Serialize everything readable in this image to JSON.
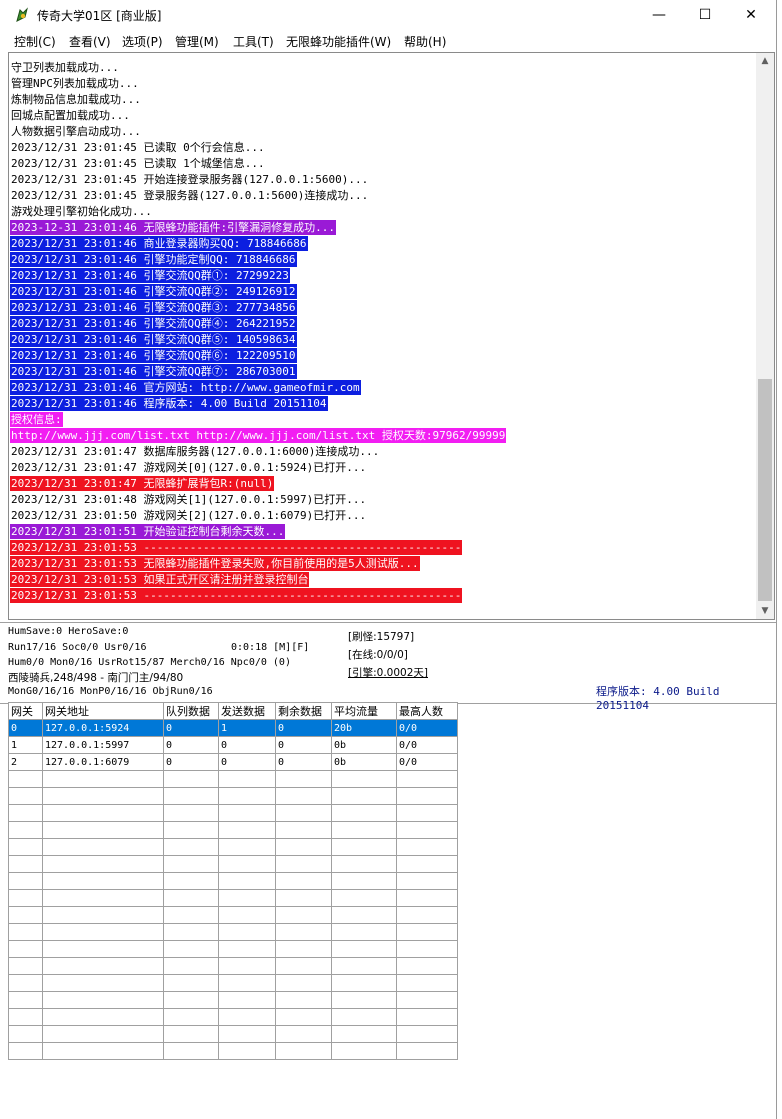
{
  "window": {
    "title": "传奇大学01区 [商业版]",
    "minimize": "—",
    "maximize": "☐",
    "close": "✕"
  },
  "menu": [
    "控制(C)",
    "查看(V)",
    "选项(P)",
    "管理(M)",
    "工具(T)",
    "无限蜂功能插件(W)",
    "帮助(H)"
  ],
  "log": [
    {
      "text": "守卫列表加载成功...",
      "style": ""
    },
    {
      "text": "管理NPC列表加载成功...",
      "style": ""
    },
    {
      "text": "炼制物品信息加载成功...",
      "style": ""
    },
    {
      "text": "回城点配置加载成功...",
      "style": ""
    },
    {
      "text": "人物数据引擎启动成功...",
      "style": ""
    },
    {
      "text": "2023/12/31 23:01:45 已读取 0个行会信息...",
      "style": ""
    },
    {
      "text": "2023/12/31 23:01:45 已读取 1个城堡信息...",
      "style": ""
    },
    {
      "text": "2023/12/31 23:01:45 开始连接登录服务器(127.0.0.1:5600)...",
      "style": ""
    },
    {
      "text": "2023/12/31 23:01:45 登录服务器(127.0.0.1:5600)连接成功...",
      "style": ""
    },
    {
      "text": "游戏处理引擎初始化成功...",
      "style": ""
    },
    {
      "text": "2023-12-31 23:01:46 无限蜂功能插件:引擎漏洞修复成功...",
      "style": "purple"
    },
    {
      "text": "2023/12/31 23:01:46 商业登录器购买QQ: 718846686",
      "style": "blue"
    },
    {
      "text": "2023/12/31 23:01:46 引擎功能定制QQ: 718846686",
      "style": "blue"
    },
    {
      "text": "2023/12/31 23:01:46 引擎交流QQ群①: 27299223",
      "style": "blue"
    },
    {
      "text": "2023/12/31 23:01:46 引擎交流QQ群②: 249126912",
      "style": "blue"
    },
    {
      "text": "2023/12/31 23:01:46 引擎交流QQ群③: 277734856",
      "style": "blue"
    },
    {
      "text": "2023/12/31 23:01:46 引擎交流QQ群④: 264221952",
      "style": "blue"
    },
    {
      "text": "2023/12/31 23:01:46 引擎交流QQ群⑤: 140598634",
      "style": "blue"
    },
    {
      "text": "2023/12/31 23:01:46 引擎交流QQ群⑥: 122209510",
      "style": "blue"
    },
    {
      "text": "2023/12/31 23:01:46 引擎交流QQ群⑦: 286703001",
      "style": "blue"
    },
    {
      "text": "2023/12/31 23:01:46 官方网站: http://www.gameofmir.com",
      "style": "blue"
    },
    {
      "text": "2023/12/31 23:01:46 程序版本: 4.00 Build 20151104",
      "style": "blue"
    },
    {
      "text": "授权信息:",
      "style": "magenta"
    },
    {
      "text": "http://www.jjj.com/list.txt http://www.jjj.com/list.txt 授权天数:97962/99999",
      "style": "magenta"
    },
    {
      "text": "2023/12/31 23:01:47 数据库服务器(127.0.0.1:6000)连接成功...",
      "style": ""
    },
    {
      "text": "2023/12/31 23:01:47 游戏网关[0](127.0.0.1:5924)已打开...",
      "style": ""
    },
    {
      "text": "2023/12/31 23:01:47 无限蜂扩展背包R:(null)",
      "style": "red"
    },
    {
      "text": "2023/12/31 23:01:48 游戏网关[1](127.0.0.1:5997)已打开...",
      "style": ""
    },
    {
      "text": "2023/12/31 23:01:50 游戏网关[2](127.0.0.1:6079)已打开...",
      "style": ""
    },
    {
      "text": "2023/12/31 23:01:51 开始验证控制台剩余天数...",
      "style": "purple"
    },
    {
      "text": "2023/12/31 23:01:53 ------------------------------------------------",
      "style": "red"
    },
    {
      "text": "2023/12/31 23:01:53 无限蜂功能插件登录失败,你目前使用的是5人测试版...",
      "style": "red"
    },
    {
      "text": "2023/12/31 23:01:53 如果正式开区请注册并登录控制台",
      "style": "red"
    },
    {
      "text": "2023/12/31 23:01:53 ------------------------------------------------",
      "style": "red"
    }
  ],
  "status": {
    "line1": "HumSave:0 HeroSave:0",
    "line2": "Run17/16 Soc0/0 Usr0/16",
    "timer": "0:0:18 [M][F]",
    "line3": "Hum0/0 Mon0/16 UsrRot15/87 Merch0/16 Npc0/0 (0)",
    "line4": "西陵骑兵,248/498 - 南门门主/94/80",
    "line5": "MonG0/16/16 MonP0/16/16 ObjRun0/16",
    "refresh": "[刷怪:15797]",
    "online": "[在线:0/0/0]",
    "engine": "[引擎:0.0002天]",
    "version": "程序版本: 4.00 Build 20151104"
  },
  "gateway_table": {
    "headers": [
      "网关",
      "网关地址",
      "队列数据",
      "发送数据",
      "剩余数据",
      "平均流量",
      "最高人数"
    ],
    "rows": [
      [
        "0",
        "127.0.0.1:5924",
        "0",
        "1",
        "0",
        "20b",
        "0/0"
      ],
      [
        "1",
        "127.0.0.1:5997",
        "0",
        "0",
        "0",
        "0b",
        "0/0"
      ],
      [
        "2",
        "127.0.0.1:6079",
        "0",
        "0",
        "0",
        "0b",
        "0/0"
      ]
    ],
    "selected_row": 0,
    "empty_rows": 17
  },
  "colors": {
    "purple": "#9a1ad6",
    "blue": "#0c1fe0",
    "magenta": "#f21ef2",
    "red": "#ef1320",
    "selection": "#0078d7"
  }
}
